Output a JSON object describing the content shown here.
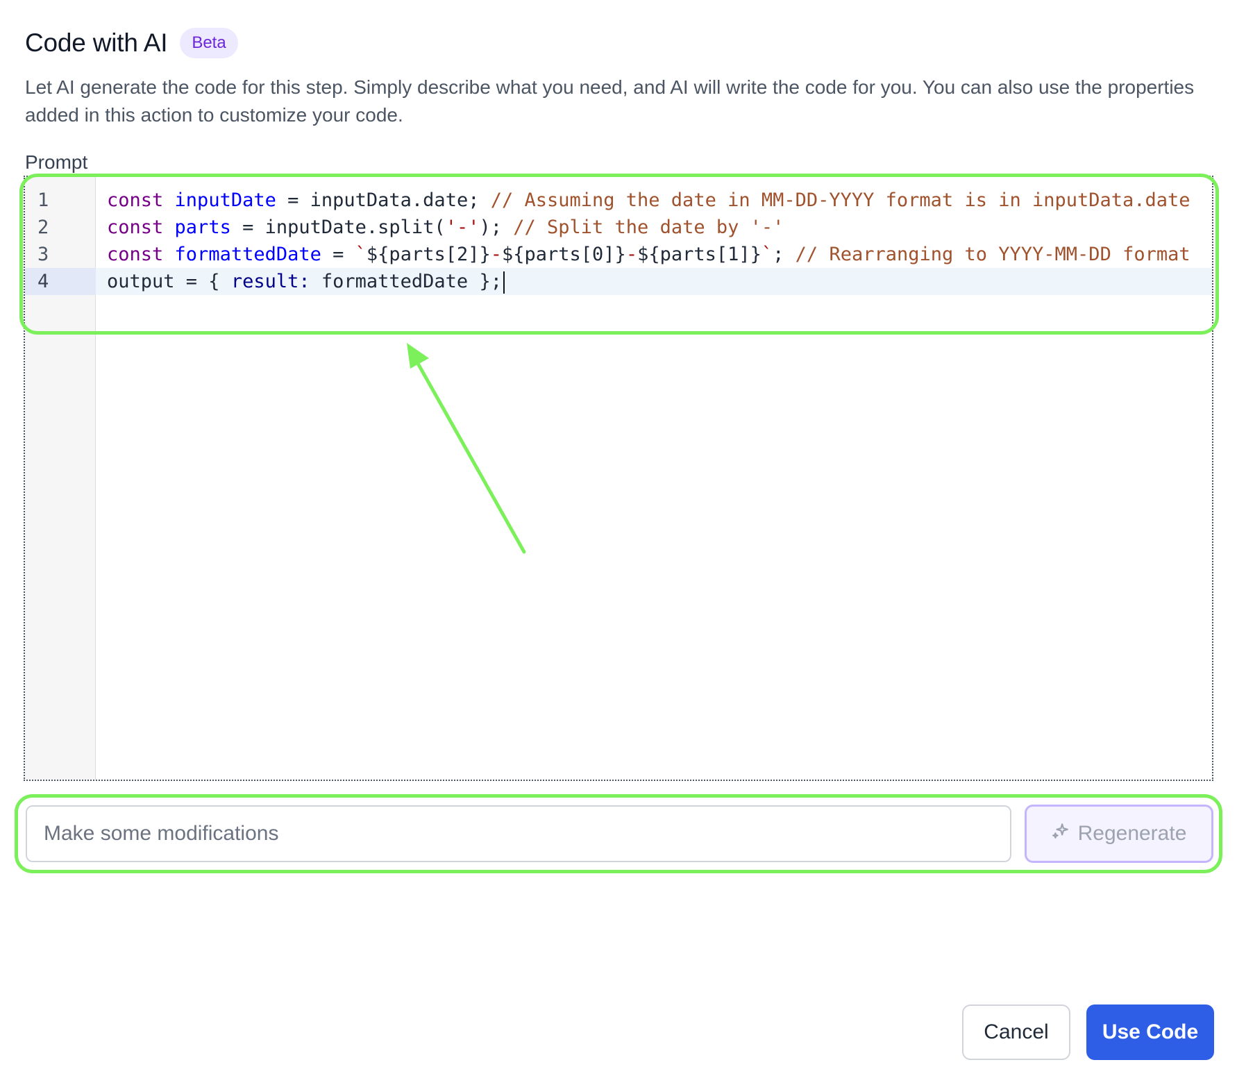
{
  "header": {
    "title": "Code with AI",
    "badge": "Beta"
  },
  "description": "Let AI generate the code for this step. Simply describe what you need, and AI will write the code for you. You can also use the properties added in this action to customize your code.",
  "prompt_label": "Prompt",
  "editor": {
    "active_line": 4,
    "lines": [
      {
        "number": "1",
        "tokens": [
          {
            "type": "kw",
            "text": "const "
          },
          {
            "type": "def",
            "text": "inputDate"
          },
          {
            "type": "var",
            "text": " = inputData.date; "
          },
          {
            "type": "cmt",
            "text": "// Assuming the date in MM-DD-YYYY format is in inputData.date"
          }
        ]
      },
      {
        "number": "2",
        "tokens": [
          {
            "type": "kw",
            "text": "const "
          },
          {
            "type": "def",
            "text": "parts"
          },
          {
            "type": "var",
            "text": " = inputDate.split("
          },
          {
            "type": "str",
            "text": "'-'"
          },
          {
            "type": "var",
            "text": "); "
          },
          {
            "type": "cmt",
            "text": "// Split the date by '-'"
          }
        ]
      },
      {
        "number": "3",
        "tokens": [
          {
            "type": "kw",
            "text": "const "
          },
          {
            "type": "def",
            "text": "formattedDate"
          },
          {
            "type": "var",
            "text": " = "
          },
          {
            "type": "str",
            "text": "`"
          },
          {
            "type": "var",
            "text": "${parts[2]}"
          },
          {
            "type": "str",
            "text": "-"
          },
          {
            "type": "var",
            "text": "${parts[0]}"
          },
          {
            "type": "str",
            "text": "-"
          },
          {
            "type": "var",
            "text": "${parts[1]}"
          },
          {
            "type": "str",
            "text": "`"
          },
          {
            "type": "var",
            "text": "; "
          },
          {
            "type": "cmt",
            "text": "// Rearranging to YYYY-MM-DD format"
          }
        ]
      },
      {
        "number": "4",
        "tokens": [
          {
            "type": "var",
            "text": "output = { "
          },
          {
            "type": "prop",
            "text": "result:"
          },
          {
            "type": "var",
            "text": " formattedDate };"
          }
        ]
      }
    ]
  },
  "modification": {
    "placeholder": "Make some modifications",
    "value": "",
    "regenerate_label": "Regenerate",
    "regenerate_icon": "sparkle-icon"
  },
  "footer": {
    "cancel_label": "Cancel",
    "use_code_label": "Use Code"
  },
  "colors": {
    "accent": "#2f5ee6",
    "badge_bg": "#ede9fe",
    "badge_text": "#6d28d9",
    "annotation": "#7cf05a"
  }
}
